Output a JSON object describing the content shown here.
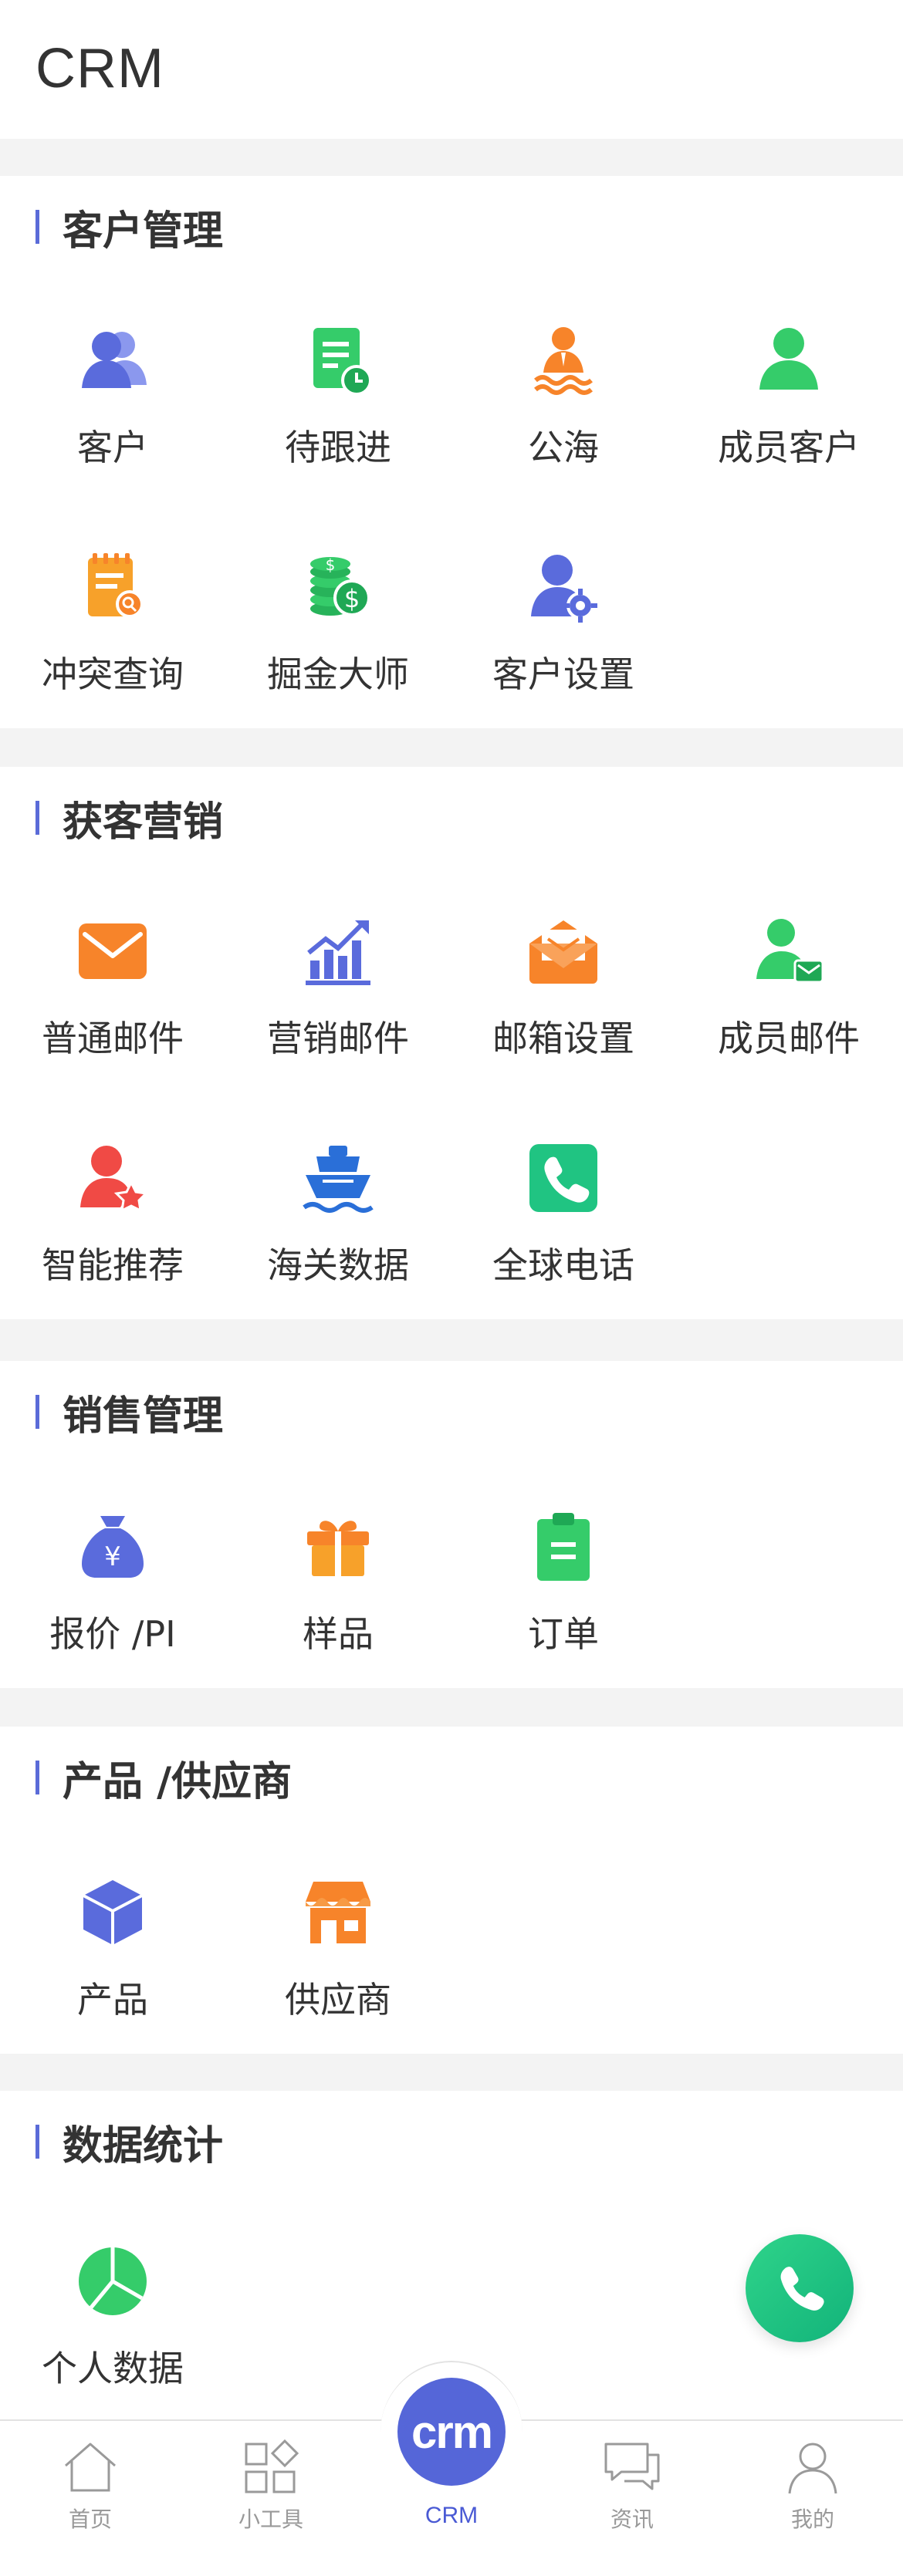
{
  "header": {
    "title": "CRM"
  },
  "sections": [
    {
      "title": "客户管理",
      "items": [
        {
          "label": "客户",
          "icon": "customers-icon"
        },
        {
          "label": "待跟进",
          "icon": "followup-icon"
        },
        {
          "label": "公海",
          "icon": "public-pool-icon"
        },
        {
          "label": "成员客户",
          "icon": "member-customer-icon"
        },
        {
          "label": "冲突查询",
          "icon": "conflict-query-icon"
        },
        {
          "label": "掘金大师",
          "icon": "coins-icon"
        },
        {
          "label": "客户设置",
          "icon": "customer-settings-icon"
        }
      ]
    },
    {
      "title": "获客营销",
      "items": [
        {
          "label": "普通邮件",
          "icon": "mail-icon"
        },
        {
          "label": "营销邮件",
          "icon": "marketing-chart-icon"
        },
        {
          "label": "邮箱设置",
          "icon": "mailbox-settings-icon"
        },
        {
          "label": "成员邮件",
          "icon": "member-mail-icon"
        },
        {
          "label": "智能推荐",
          "icon": "smart-recommend-icon"
        },
        {
          "label": "海关数据",
          "icon": "ship-icon"
        },
        {
          "label": "全球电话",
          "icon": "phone-icon"
        }
      ]
    },
    {
      "title": "销售管理",
      "items": [
        {
          "label": "报价 /PI",
          "icon": "money-bag-icon"
        },
        {
          "label": "样品",
          "icon": "gift-icon"
        },
        {
          "label": "订单",
          "icon": "clipboard-icon"
        }
      ]
    },
    {
      "title": "产品 /供应商",
      "items": [
        {
          "label": "产品",
          "icon": "cube-icon"
        },
        {
          "label": "供应商",
          "icon": "store-icon"
        }
      ]
    },
    {
      "title": "数据统计",
      "items": [
        {
          "label": "个人数据",
          "icon": "pie-chart-icon"
        }
      ]
    }
  ],
  "tabbar": {
    "tabs": [
      {
        "label": "首页",
        "icon": "home-icon"
      },
      {
        "label": "小工具",
        "icon": "tools-icon"
      },
      {
        "label": "CRM",
        "icon": "crm-icon",
        "logo": "crm"
      },
      {
        "label": "资讯",
        "icon": "chat-icon"
      },
      {
        "label": "我的",
        "icon": "user-icon"
      }
    ],
    "active": "CRM"
  },
  "colors": {
    "accent": "#5a6bd8",
    "blue": "#5e6fe0",
    "green": "#35cc6a",
    "orange": "#f7842a",
    "red": "#f04a45",
    "fab": "#1bc47d"
  }
}
